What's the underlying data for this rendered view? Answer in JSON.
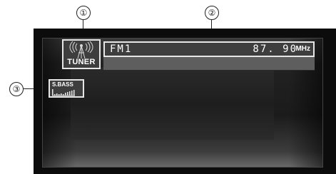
{
  "callouts": {
    "tuner_ref": "①",
    "display_ref": "②",
    "sbass_ref": "③"
  },
  "display": {
    "source_label": "TUNER",
    "band": "FM1",
    "frequency": "87. 90",
    "unit": "MHz",
    "sbass_label": "S.BASS"
  },
  "colors": {
    "screen_bg": "#0c0c0c",
    "indicator_bg": "#3e3e3e",
    "indicator_border": "#e6e6e6",
    "text": "#ffffff"
  },
  "icons": [
    "antenna-icon",
    "level-meter-icon"
  ]
}
